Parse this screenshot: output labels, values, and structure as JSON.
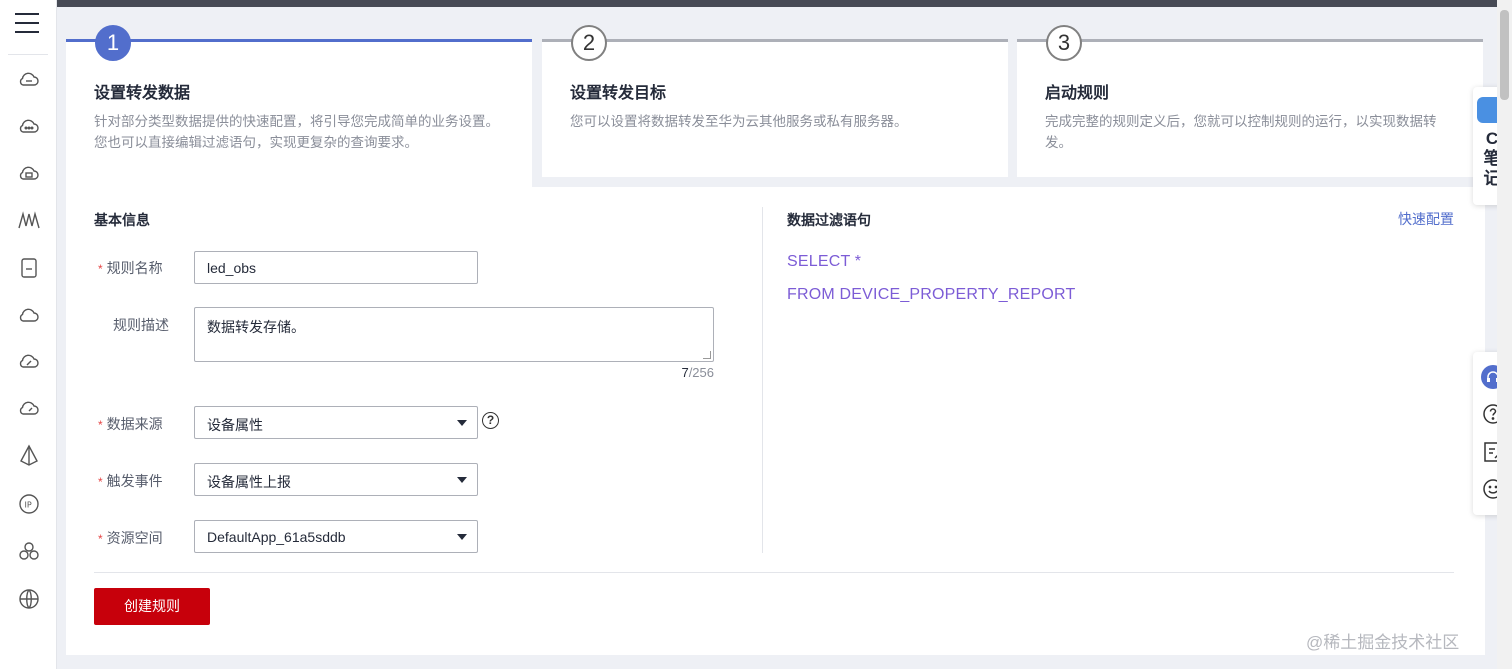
{
  "sidebar": {
    "icons": [
      "menu-icon",
      "cloud-icon",
      "cloud-dots-icon",
      "cloud-chip-icon",
      "signal-wave-icon",
      "device-icon",
      "cloud-outline-icon",
      "cloud-link-icon",
      "cloud-speed-icon",
      "pyramid-icon",
      "ip-icon",
      "cluster-icon",
      "globe-icon"
    ]
  },
  "steps": [
    {
      "number": "1",
      "title": "设置转发数据",
      "desc": "针对部分类型数据提供的快速配置，将引导您完成简单的业务设置。您也可以直接编辑过滤语句，实现更复杂的查询要求。",
      "active": true
    },
    {
      "number": "2",
      "title": "设置转发目标",
      "desc": "您可以设置将数据转发至华为云其他服务或私有服务器。",
      "active": false
    },
    {
      "number": "3",
      "title": "启动规则",
      "desc": "完成完整的规则定义后，您就可以控制规则的运行，以实现数据转发。",
      "active": false
    }
  ],
  "basic_info": {
    "title": "基本信息",
    "rule_name_label": "规则名称",
    "rule_name_value": "led_obs",
    "rule_desc_label": "规则描述",
    "rule_desc_value": "数据转发存储。",
    "desc_count": "7",
    "desc_max": "/256",
    "data_source_label": "数据来源",
    "data_source_value": "设备属性",
    "trigger_label": "触发事件",
    "trigger_value": "设备属性上报",
    "resource_label": "资源空间",
    "resource_value": "DefaultApp_61a5sddb",
    "help_glyph": "?"
  },
  "filter": {
    "title": "数据过滤语句",
    "quick_config": "快速配置",
    "sql_line1": "SELECT *",
    "sql_line2": "FROM DEVICE_PROPERTY_REPORT"
  },
  "actions": {
    "create_label": "创建规则"
  },
  "float_note": {
    "text": "C笔记"
  },
  "watermark": "@稀土掘金技术社区",
  "colors": {
    "accent": "#526ecc",
    "primary_button": "#c7000b",
    "sql_text": "#7c5cd6",
    "required": "#e54545"
  }
}
